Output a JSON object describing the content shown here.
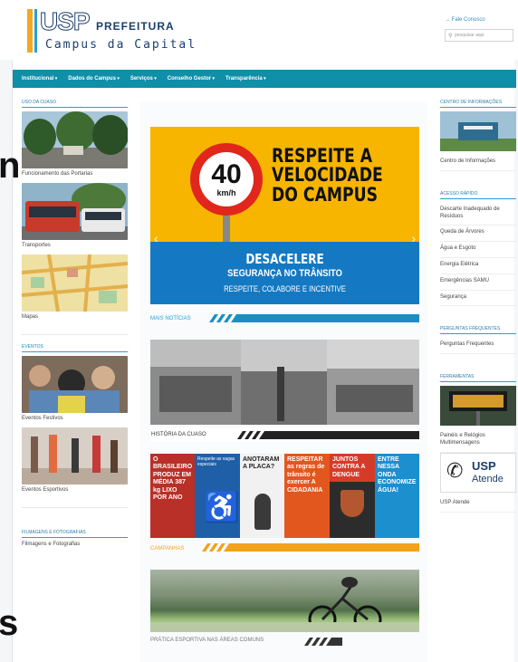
{
  "header": {
    "logo_usp": "USP",
    "logo_prefeitura": "PREFEITURA",
    "logo_campus": "Campus da Capital",
    "fale_conosco": "→ Fale Conosco",
    "search_placeholder": "pesquisar aqui"
  },
  "nav": {
    "items": [
      {
        "label": "Institucional"
      },
      {
        "label": "Dados do Campus"
      },
      {
        "label": "Serviços"
      },
      {
        "label": "Conselho Gestor"
      },
      {
        "label": "Transparência"
      }
    ]
  },
  "edge_chars": [
    "n",
    "s"
  ],
  "left_col": {
    "section1": "USO DA CUASO",
    "items1": [
      {
        "caption": "Funcionamento das Portarias"
      },
      {
        "caption": "Transportes"
      },
      {
        "caption": "Mapas"
      }
    ],
    "section2": "EVENTOS",
    "items2": [
      {
        "caption": "Eventos Festivos"
      },
      {
        "caption": "Eventos Esportivos"
      }
    ],
    "section3": "FILMAGENS E FOTOGRAFIAS",
    "items3": [
      {
        "caption": "Filmagens e Fotografias"
      }
    ]
  },
  "banner": {
    "speed": "40",
    "unit": "km/h",
    "title": "RESPEITE A VELOCIDADE DO CAMPUS",
    "sub1": "DESACELERE",
    "sub2": "SEGURANÇA NO TRÂNSITO",
    "sub3": "RESPEITE, COLABORE E INCENTIVE",
    "prev": "‹",
    "next": "›"
  },
  "main": {
    "mais_noticias": "MAIS NOTÍCIAS",
    "news_caption": "HISTÓRIA DA CUASO",
    "campanhas": "CAMPANHAS",
    "sport_caption": "PRÁTICA ESPORTIVA NAS ÁREAS COMUNS",
    "campaigns": [
      {
        "text": "O BRASILEIRO PRODUZ EM MÉDIA 387 kg LIXO POR ANO",
        "color": "#c0392b"
      },
      {
        "text": "Respeite as vagas especiais",
        "color": "#1f5fa8"
      },
      {
        "text": "ANOTARAM A PLACA?",
        "color": "#f1f1f1"
      },
      {
        "text": "RESPEITAR as regras de trânsito é exercer A CIDADANIA",
        "color": "#e2571e"
      },
      {
        "text": "JUNTOS CONTRA A DENGUE",
        "color": "#2c2c2c"
      },
      {
        "text": "ENTRE NESSA ONDA ECONOMIZE ÁGUA!",
        "color": "#1c8fcf"
      }
    ]
  },
  "right_col": {
    "section1": "CENTRO DE INFORMAÇÕES",
    "info_caption": "Centro de Informações",
    "section2": "ACESSO RÁPIDO",
    "quick_links": [
      {
        "label": "Descarte Inadequado de Resíduos"
      },
      {
        "label": "Queda de Árvores"
      },
      {
        "label": "Água e Esgoto"
      },
      {
        "label": "Energia Elétrica"
      },
      {
        "label": "Emergências SAMU"
      },
      {
        "label": "Segurança"
      }
    ],
    "section3": "PERGUNTAS FREQUENTES",
    "faq_link": "Perguntas Frequentes",
    "section4": "FERRAMENTAS",
    "tools": [
      {
        "label": "Painéis e Relógios Multimensagens"
      },
      {
        "label": "USP Atende"
      }
    ],
    "usp_atende_logo": "USP",
    "usp_atende_text": "Atende"
  }
}
